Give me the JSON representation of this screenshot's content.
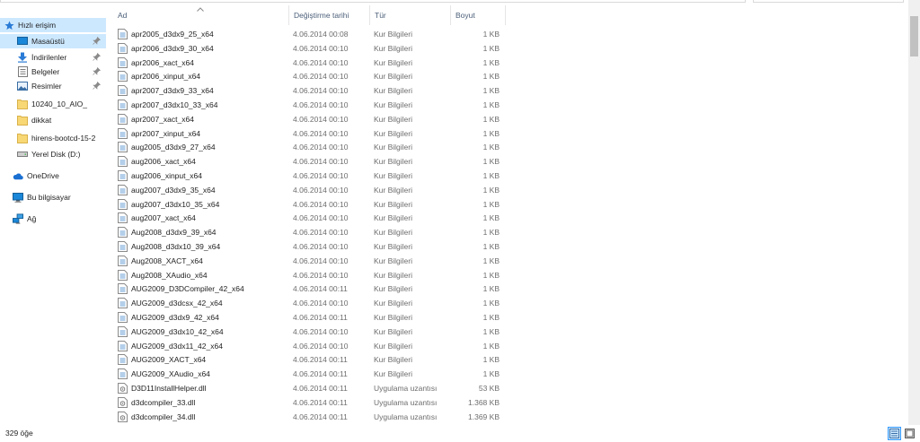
{
  "nav": {
    "quick_access": "Hızlı erişim",
    "items": [
      {
        "label": "Masaüstü",
        "icon": "desktop-icon",
        "pinned": true
      },
      {
        "label": "İndirilenler",
        "icon": "download-icon",
        "pinned": true
      },
      {
        "label": "Belgeler",
        "icon": "documents-icon",
        "pinned": true
      },
      {
        "label": "Resimler",
        "icon": "pictures-icon",
        "pinned": true
      },
      {
        "label": "10240_10_AIO_",
        "icon": "folder-icon",
        "pinned": false
      },
      {
        "label": "dikkat",
        "icon": "folder-icon",
        "pinned": false
      },
      {
        "label": "hirens-bootcd-15-2",
        "icon": "folder-icon",
        "pinned": false
      },
      {
        "label": "Yerel Disk (D:)",
        "icon": "drive-icon",
        "pinned": false
      }
    ],
    "onedrive": "OneDrive",
    "this_pc": "Bu bilgisayar",
    "network": "Ağ"
  },
  "columns": {
    "name": "Ad",
    "date": "Değiştirme tarihi",
    "type": "Tür",
    "size": "Boyut"
  },
  "files": [
    {
      "name": "apr2005_d3dx9_25_x64",
      "date": "4.06.2014 00:08",
      "type": "Kur Bilgileri",
      "size": "1 KB",
      "kind": "inf"
    },
    {
      "name": "apr2006_d3dx9_30_x64",
      "date": "4.06.2014 00:10",
      "type": "Kur Bilgileri",
      "size": "1 KB",
      "kind": "inf"
    },
    {
      "name": "apr2006_xact_x64",
      "date": "4.06.2014 00:10",
      "type": "Kur Bilgileri",
      "size": "1 KB",
      "kind": "inf"
    },
    {
      "name": "apr2006_xinput_x64",
      "date": "4.06.2014 00:10",
      "type": "Kur Bilgileri",
      "size": "1 KB",
      "kind": "inf"
    },
    {
      "name": "apr2007_d3dx9_33_x64",
      "date": "4.06.2014 00:10",
      "type": "Kur Bilgileri",
      "size": "1 KB",
      "kind": "inf"
    },
    {
      "name": "apr2007_d3dx10_33_x64",
      "date": "4.06.2014 00:10",
      "type": "Kur Bilgileri",
      "size": "1 KB",
      "kind": "inf"
    },
    {
      "name": "apr2007_xact_x64",
      "date": "4.06.2014 00:10",
      "type": "Kur Bilgileri",
      "size": "1 KB",
      "kind": "inf"
    },
    {
      "name": "apr2007_xinput_x64",
      "date": "4.06.2014 00:10",
      "type": "Kur Bilgileri",
      "size": "1 KB",
      "kind": "inf"
    },
    {
      "name": "aug2005_d3dx9_27_x64",
      "date": "4.06.2014 00:10",
      "type": "Kur Bilgileri",
      "size": "1 KB",
      "kind": "inf"
    },
    {
      "name": "aug2006_xact_x64",
      "date": "4.06.2014 00:10",
      "type": "Kur Bilgileri",
      "size": "1 KB",
      "kind": "inf"
    },
    {
      "name": "aug2006_xinput_x64",
      "date": "4.06.2014 00:10",
      "type": "Kur Bilgileri",
      "size": "1 KB",
      "kind": "inf"
    },
    {
      "name": "aug2007_d3dx9_35_x64",
      "date": "4.06.2014 00:10",
      "type": "Kur Bilgileri",
      "size": "1 KB",
      "kind": "inf"
    },
    {
      "name": "aug2007_d3dx10_35_x64",
      "date": "4.06.2014 00:10",
      "type": "Kur Bilgileri",
      "size": "1 KB",
      "kind": "inf"
    },
    {
      "name": "aug2007_xact_x64",
      "date": "4.06.2014 00:10",
      "type": "Kur Bilgileri",
      "size": "1 KB",
      "kind": "inf"
    },
    {
      "name": "Aug2008_d3dx9_39_x64",
      "date": "4.06.2014 00:10",
      "type": "Kur Bilgileri",
      "size": "1 KB",
      "kind": "inf"
    },
    {
      "name": "Aug2008_d3dx10_39_x64",
      "date": "4.06.2014 00:10",
      "type": "Kur Bilgileri",
      "size": "1 KB",
      "kind": "inf"
    },
    {
      "name": "Aug2008_XACT_x64",
      "date": "4.06.2014 00:10",
      "type": "Kur Bilgileri",
      "size": "1 KB",
      "kind": "inf"
    },
    {
      "name": "Aug2008_XAudio_x64",
      "date": "4.06.2014 00:10",
      "type": "Kur Bilgileri",
      "size": "1 KB",
      "kind": "inf"
    },
    {
      "name": "AUG2009_D3DCompiler_42_x64",
      "date": "4.06.2014 00:11",
      "type": "Kur Bilgileri",
      "size": "1 KB",
      "kind": "inf"
    },
    {
      "name": "AUG2009_d3dcsx_42_x64",
      "date": "4.06.2014 00:10",
      "type": "Kur Bilgileri",
      "size": "1 KB",
      "kind": "inf"
    },
    {
      "name": "AUG2009_d3dx9_42_x64",
      "date": "4.06.2014 00:11",
      "type": "Kur Bilgileri",
      "size": "1 KB",
      "kind": "inf"
    },
    {
      "name": "AUG2009_d3dx10_42_x64",
      "date": "4.06.2014 00:10",
      "type": "Kur Bilgileri",
      "size": "1 KB",
      "kind": "inf"
    },
    {
      "name": "AUG2009_d3dx11_42_x64",
      "date": "4.06.2014 00:10",
      "type": "Kur Bilgileri",
      "size": "1 KB",
      "kind": "inf"
    },
    {
      "name": "AUG2009_XACT_x64",
      "date": "4.06.2014 00:11",
      "type": "Kur Bilgileri",
      "size": "1 KB",
      "kind": "inf"
    },
    {
      "name": "AUG2009_XAudio_x64",
      "date": "4.06.2014 00:11",
      "type": "Kur Bilgileri",
      "size": "1 KB",
      "kind": "inf"
    },
    {
      "name": "D3D11InstallHelper.dll",
      "date": "4.06.2014 00:11",
      "type": "Uygulama uzantısı",
      "size": "53 KB",
      "kind": "dll"
    },
    {
      "name": "d3dcompiler_33.dll",
      "date": "4.06.2014 00:11",
      "type": "Uygulama uzantısı",
      "size": "1.368 KB",
      "kind": "dll"
    },
    {
      "name": "d3dcompiler_34.dll",
      "date": "4.06.2014 00:11",
      "type": "Uygulama uzantısı",
      "size": "1.369 KB",
      "kind": "dll"
    }
  ],
  "status": {
    "item_count": "329 öğe"
  },
  "colors": {
    "selection": "#cce8ff",
    "header_text": "#4c607a",
    "folder": "#f8d775",
    "accent": "#3399ff"
  }
}
